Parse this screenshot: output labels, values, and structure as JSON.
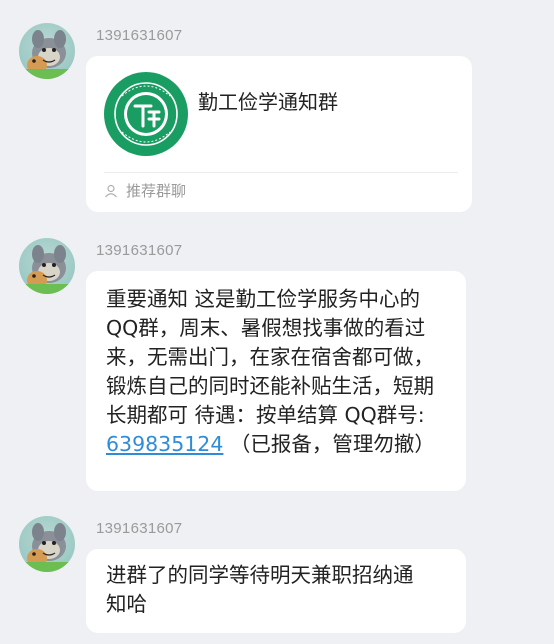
{
  "messages": [
    {
      "sender": "1391631607",
      "card": {
        "group_name": "勤工俭学通知群",
        "footer_label": "推荐群聊",
        "logo_icon": "group-logo-icon"
      }
    },
    {
      "sender": "1391631607",
      "text_before": "重要通知 这是勤工俭学服务中心的QQ群，周末、暑假想找事做的看过来，无需出门，在家在宿舍都可做，锻炼自己的同时还能补贴生活，短期长期都可 待遇：按单结算 QQ群号: ",
      "link_text": "639835124",
      "text_after": " （已报备，管理勿撤）"
    },
    {
      "sender": "1391631607",
      "text": "进群了的同学等待明天兼职招纳通知哈"
    }
  ],
  "colors": {
    "background": "#eef0f3",
    "bubble": "#ffffff",
    "link": "#2f8cd8",
    "logo_green": "#1a9d63",
    "sender_gray": "#9a9a9a"
  }
}
